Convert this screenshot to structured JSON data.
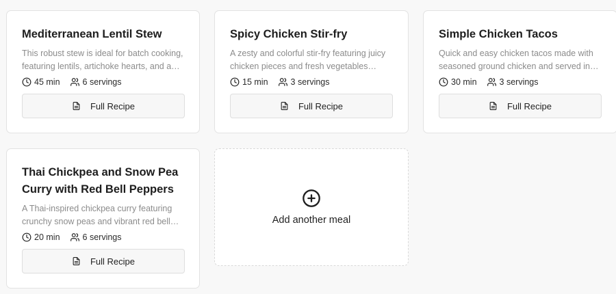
{
  "meals": [
    {
      "title": "Mediterranean Lentil Stew",
      "description": "This robust stew is ideal for batch cooking, featuring lentils, artichoke hearts, and a…",
      "time": "45 min",
      "servings": "6 servings",
      "button_label": "Full Recipe"
    },
    {
      "title": "Spicy Chicken Stir-fry",
      "description": "A zesty and colorful stir-fry featuring juicy chicken pieces and fresh vegetables…",
      "time": "15 min",
      "servings": "3 servings",
      "button_label": "Full Recipe"
    },
    {
      "title": "Simple Chicken Tacos",
      "description": "Quick and easy chicken tacos made with seasoned ground chicken and served in…",
      "time": "30 min",
      "servings": "3 servings",
      "button_label": "Full Recipe"
    },
    {
      "title": "Thai Chickpea and Snow Pea Curry with Red Bell Peppers",
      "description": "A Thai-inspired chickpea curry featuring crunchy snow peas and vibrant red bell…",
      "time": "20 min",
      "servings": "6 servings",
      "button_label": "Full Recipe"
    }
  ],
  "add_meal": {
    "label": "Add another meal",
    "icon": "plus-circle-icon"
  },
  "icons": {
    "time": "clock-icon",
    "servings": "users-icon",
    "recipe": "document-icon"
  }
}
